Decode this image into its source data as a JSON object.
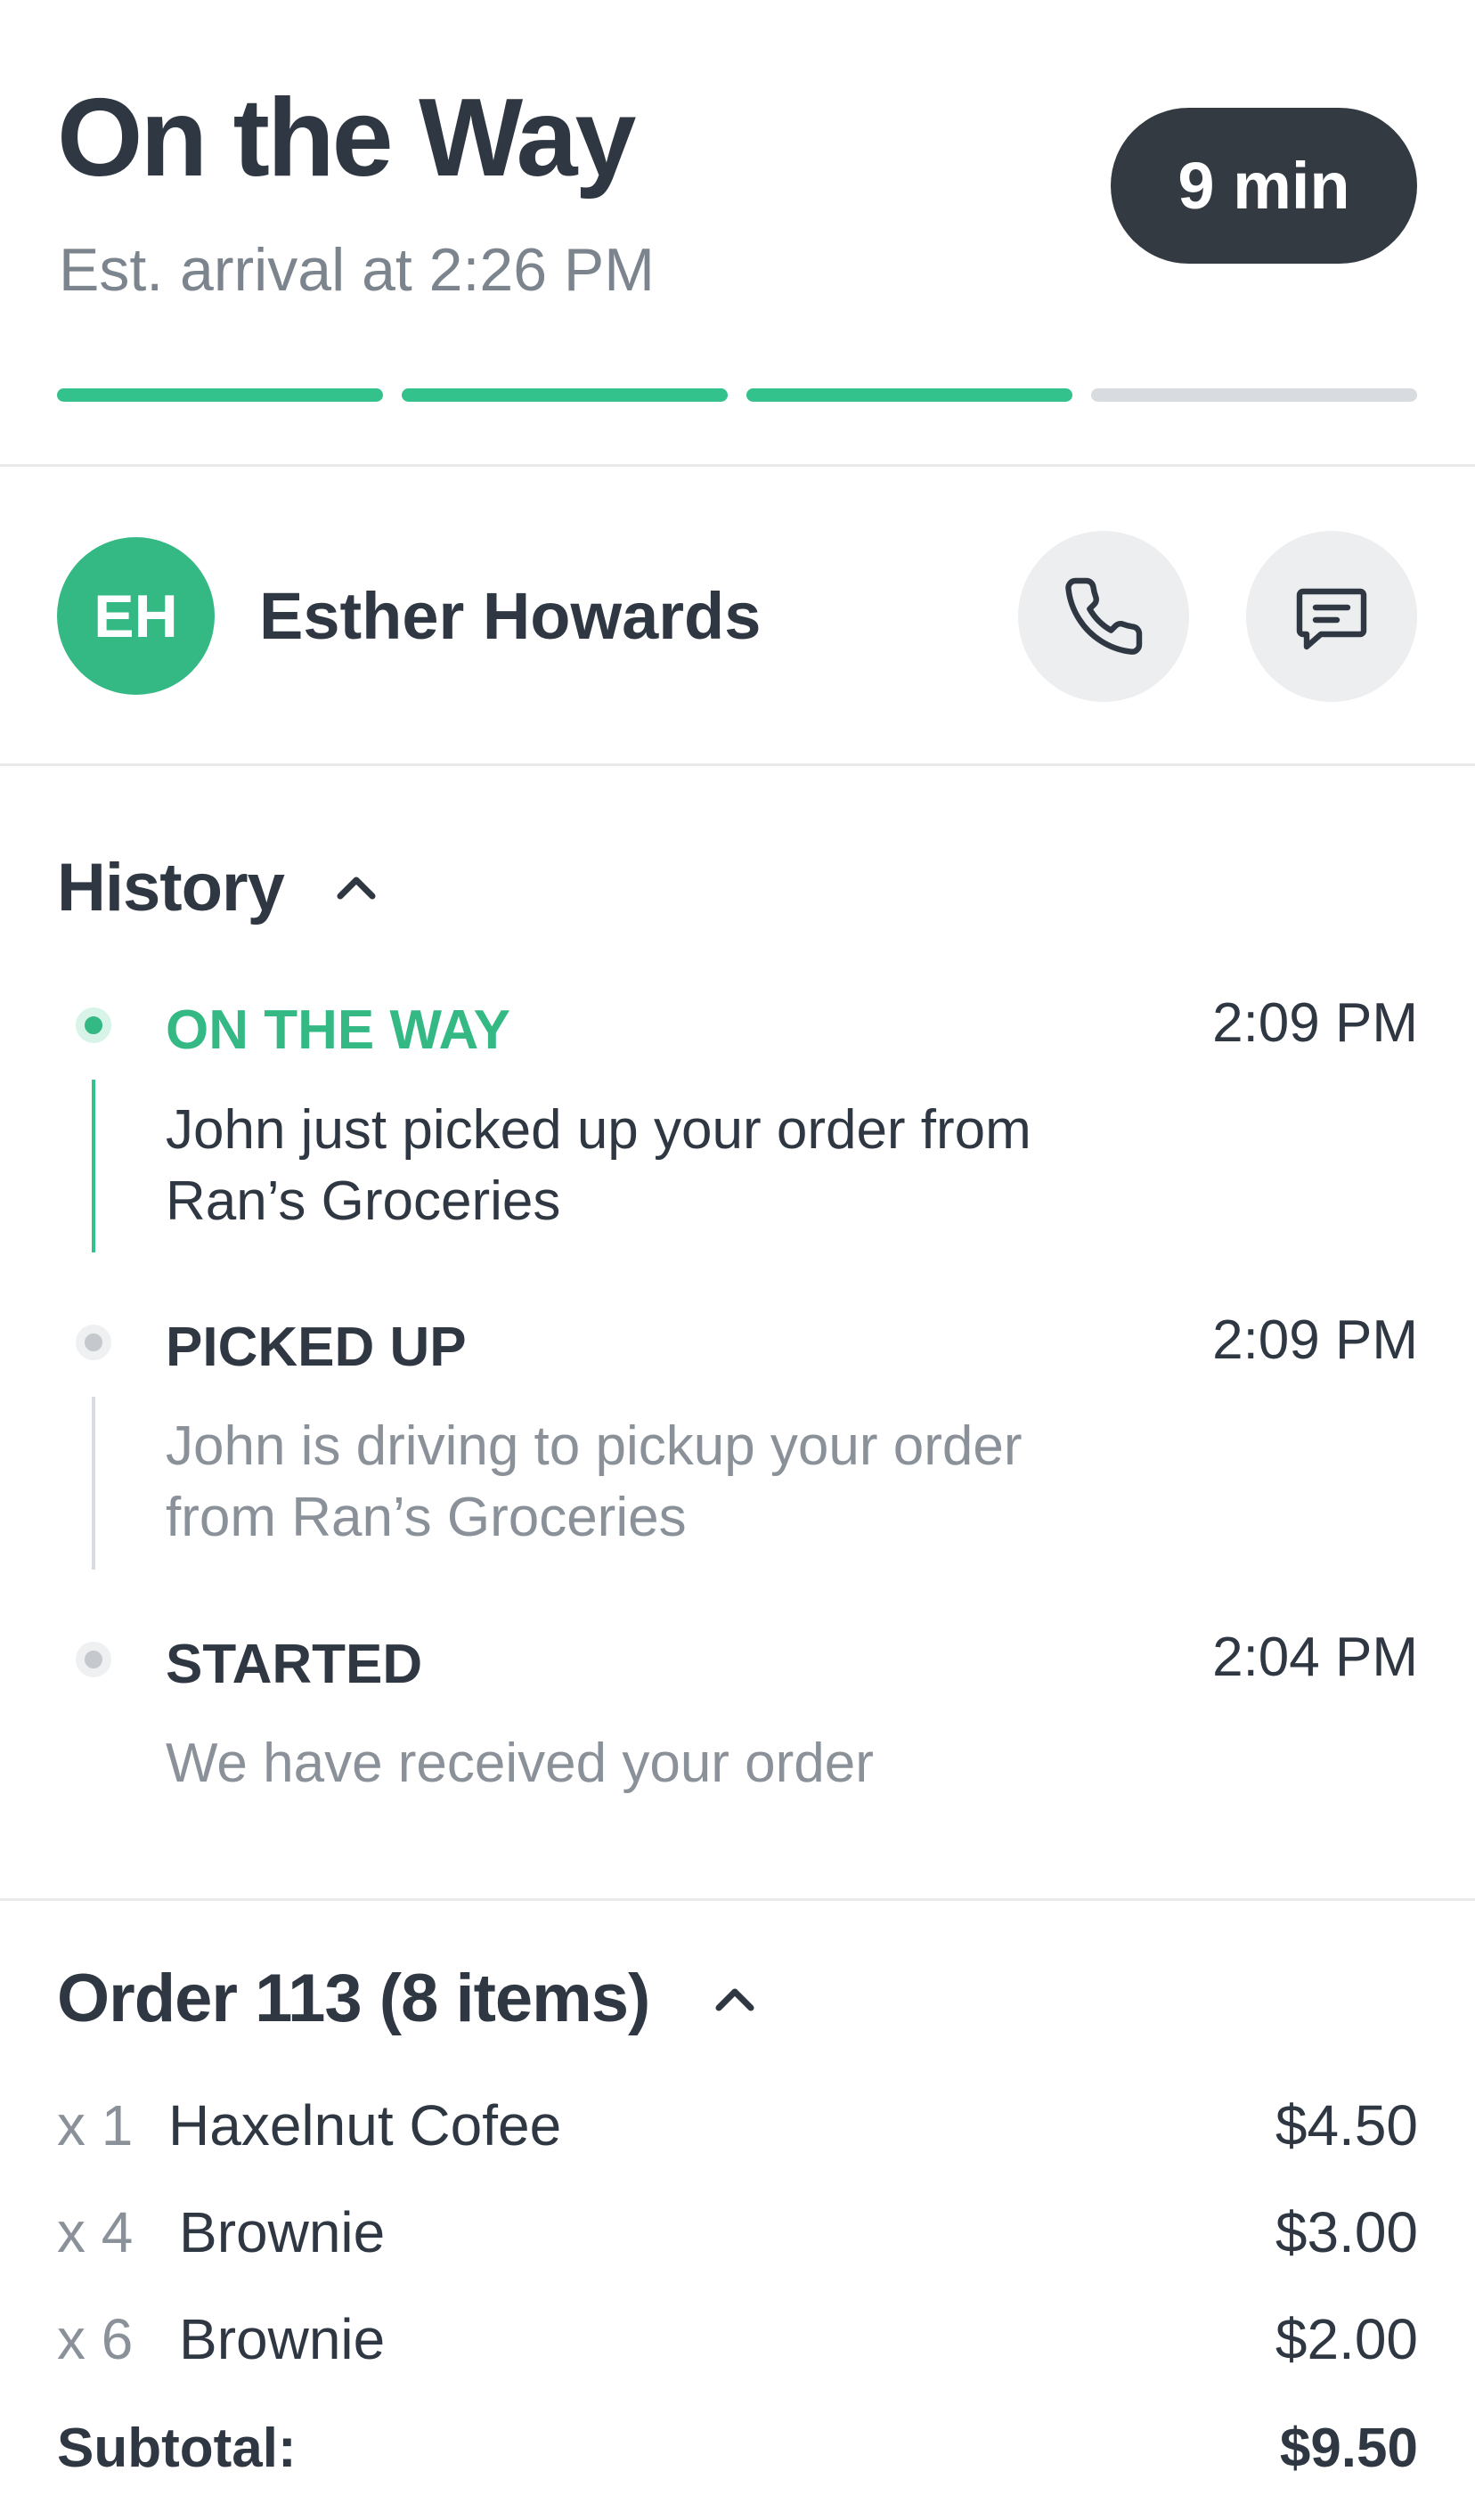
{
  "header": {
    "title": "On the Way",
    "subtitle": "Est. arrival at 2:26 PM",
    "eta_badge": "9 min",
    "progress_steps_completed": 3,
    "progress_steps_total": 4
  },
  "contact": {
    "initials": "EH",
    "name": "Esther Howards",
    "call_icon": "phone-icon",
    "message_icon": "chat-icon"
  },
  "history": {
    "title": "History",
    "toggle_icon": "chevron-up-icon",
    "events": [
      {
        "status": "ON THE WAY",
        "time": "2:09 PM",
        "description": "John just picked up your order from Ran’s Groceries"
      },
      {
        "status": "PICKED UP",
        "time": "2:09 PM",
        "description": "John is driving to pickup your order from Ran’s Groceries"
      },
      {
        "status": "STARTED",
        "time": "2:04 PM",
        "description": "We have received your order"
      }
    ]
  },
  "order": {
    "title": "Order 113 (8 items)",
    "toggle_icon": "chevron-up-icon",
    "items": [
      {
        "qty": "x 1",
        "name": "Haxelnut Cofee",
        "price": "$4.50"
      },
      {
        "qty": "x 4",
        "name": "Brownie",
        "price": "$3.00"
      },
      {
        "qty": "x 6",
        "name": "Brownie",
        "price": "$2.00"
      }
    ],
    "subtotal_label": "Subtotal:",
    "subtotal_value": "$9.50"
  },
  "colors": {
    "accent_green": "#34b985",
    "text_dark": "#2f3742",
    "text_muted": "#7c848d",
    "eta_badge_bg": "#343a42"
  }
}
